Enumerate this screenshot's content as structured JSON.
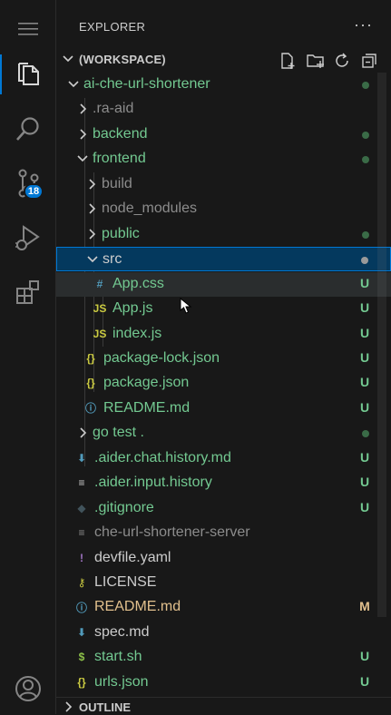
{
  "activity_bar": {
    "items": [
      {
        "name": "menu-icon"
      },
      {
        "name": "explorer-icon"
      },
      {
        "name": "search-icon"
      },
      {
        "name": "source-control-icon",
        "badge": "18"
      },
      {
        "name": "run-debug-icon"
      },
      {
        "name": "extensions-icon"
      },
      {
        "name": "accounts-icon"
      }
    ]
  },
  "explorer": {
    "title": "EXPLORER",
    "more": "···",
    "workspace": "(WORKSPACE)",
    "outline": "OUTLINE",
    "tree": [
      {
        "label": "ai-che-url-shortener",
        "type": "folder",
        "open": true,
        "depth": 0,
        "color": "green",
        "status": "dot-green"
      },
      {
        "label": ".ra-aid",
        "type": "folder",
        "open": false,
        "depth": 1,
        "color": "gray",
        "status": ""
      },
      {
        "label": "backend",
        "type": "folder",
        "open": false,
        "depth": 1,
        "color": "green",
        "status": "dot-green"
      },
      {
        "label": "frontend",
        "type": "folder",
        "open": true,
        "depth": 1,
        "color": "green",
        "status": "dot-green"
      },
      {
        "label": "build",
        "type": "folder",
        "open": false,
        "depth": 2,
        "color": "gray",
        "status": ""
      },
      {
        "label": "node_modules",
        "type": "folder",
        "open": false,
        "depth": 2,
        "color": "gray",
        "status": ""
      },
      {
        "label": "public",
        "type": "folder",
        "open": false,
        "depth": 2,
        "color": "green",
        "status": "dot-green"
      },
      {
        "label": "src",
        "type": "folder",
        "open": true,
        "depth": 2,
        "color": "white",
        "status": "dot-gray",
        "selected": true
      },
      {
        "label": "App.css",
        "type": "file",
        "icon": "#",
        "iconColor": "#519aba",
        "depth": 3,
        "color": "green",
        "status": "U",
        "hover": true
      },
      {
        "label": "App.js",
        "type": "file",
        "icon": "JS",
        "iconColor": "#cbcb41",
        "depth": 3,
        "color": "green",
        "status": "U"
      },
      {
        "label": "index.js",
        "type": "file",
        "icon": "JS",
        "iconColor": "#cbcb41",
        "depth": 3,
        "color": "green",
        "status": "U"
      },
      {
        "label": "package-lock.json",
        "type": "file",
        "icon": "{}",
        "iconColor": "#cbcb41",
        "depth": 2,
        "color": "green",
        "status": "U"
      },
      {
        "label": "package.json",
        "type": "file",
        "icon": "{}",
        "iconColor": "#cbcb41",
        "depth": 2,
        "color": "green",
        "status": "U"
      },
      {
        "label": "README.md",
        "type": "file",
        "icon": "ⓘ",
        "iconColor": "#519aba",
        "depth": 2,
        "color": "green",
        "status": "U"
      },
      {
        "label": "go test .",
        "type": "folder",
        "open": false,
        "depth": 1,
        "color": "green",
        "status": "dot-green"
      },
      {
        "label": ".aider.chat.history.md",
        "type": "file",
        "icon": "⬇",
        "iconColor": "#519aba",
        "depth": 1,
        "color": "green",
        "status": "U"
      },
      {
        "label": ".aider.input.history",
        "type": "file",
        "icon": "≡",
        "iconColor": "#cccccc",
        "depth": 1,
        "color": "green",
        "status": "U"
      },
      {
        "label": ".gitignore",
        "type": "file",
        "icon": "◆",
        "iconColor": "#41535b",
        "depth": 1,
        "color": "green",
        "status": "U"
      },
      {
        "label": "che-url-shortener-server",
        "type": "file",
        "icon": "≡",
        "iconColor": "#8c8c8c",
        "depth": 1,
        "color": "gray",
        "status": ""
      },
      {
        "label": "devfile.yaml",
        "type": "file",
        "icon": "!",
        "iconColor": "#a074c4",
        "depth": 1,
        "color": "white",
        "status": ""
      },
      {
        "label": "LICENSE",
        "type": "file",
        "icon": "⚷",
        "iconColor": "#cbcb41",
        "depth": 1,
        "color": "white",
        "status": ""
      },
      {
        "label": "README.md",
        "type": "file",
        "icon": "ⓘ",
        "iconColor": "#519aba",
        "depth": 1,
        "color": "orange",
        "status": "M"
      },
      {
        "label": "spec.md",
        "type": "file",
        "icon": "⬇",
        "iconColor": "#519aba",
        "depth": 1,
        "color": "white",
        "status": ""
      },
      {
        "label": "start.sh",
        "type": "file",
        "icon": "$",
        "iconColor": "#8dc149",
        "depth": 1,
        "color": "green",
        "status": "U"
      },
      {
        "label": "urls.json",
        "type": "file",
        "icon": "{}",
        "iconColor": "#cbcb41",
        "depth": 1,
        "color": "green",
        "status": "U"
      }
    ]
  }
}
